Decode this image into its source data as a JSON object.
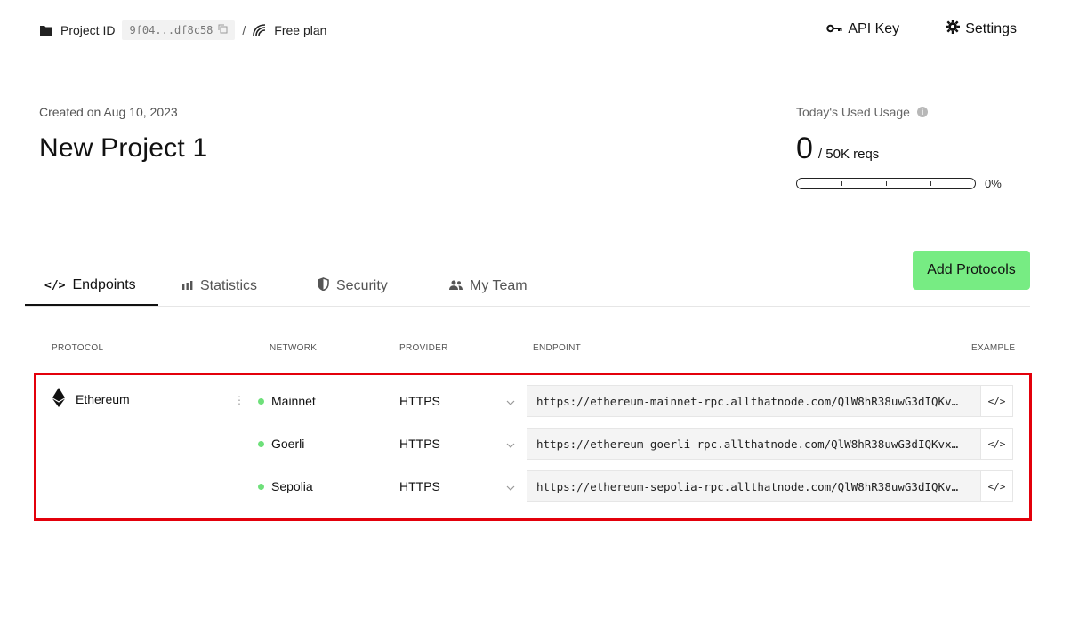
{
  "breadcrumb": {
    "project_id_label": "Project ID",
    "project_id_value": "9f04...df8c58",
    "separator": "/",
    "plan": "Free plan"
  },
  "top_actions": {
    "api_key": "API Key",
    "settings": "Settings"
  },
  "project": {
    "created": "Created on Aug 10, 2023",
    "title": "New Project 1"
  },
  "usage": {
    "label": "Today's Used Usage",
    "used": "0",
    "limit": "/ 50K reqs",
    "percent_text": "0%",
    "percent_value": 0
  },
  "tabs": [
    {
      "label": "Endpoints",
      "icon": "code-icon",
      "active": true
    },
    {
      "label": "Statistics",
      "icon": "bar-chart-icon",
      "active": false
    },
    {
      "label": "Security",
      "icon": "shield-icon",
      "active": false
    },
    {
      "label": "My Team",
      "icon": "team-icon",
      "active": false
    }
  ],
  "add_protocols": "Add Protocols",
  "table": {
    "headers": {
      "protocol": "PROTOCOL",
      "network": "NETWORK",
      "provider": "PROVIDER",
      "endpoint": "ENDPOINT",
      "example": "EXAMPLE"
    },
    "protocol": "Ethereum",
    "rows": [
      {
        "network": "Mainnet",
        "provider": "HTTPS",
        "endpoint": "https://ethereum-mainnet-rpc.allthatnode.com/QlW8hR38uwG3dIQKv…",
        "example": "</>"
      },
      {
        "network": "Goerli",
        "provider": "HTTPS",
        "endpoint": "https://ethereum-goerli-rpc.allthatnode.com/QlW8hR38uwG3dIQKvx…",
        "example": "</>"
      },
      {
        "network": "Sepolia",
        "provider": "HTTPS",
        "endpoint": "https://ethereum-sepolia-rpc.allthatnode.com/QlW8hR38uwG3dIQKv…",
        "example": "</>"
      }
    ]
  },
  "colors": {
    "accent_green": "#77ec83",
    "status_green": "#6ee07a",
    "highlight_red": "#e3000b"
  }
}
